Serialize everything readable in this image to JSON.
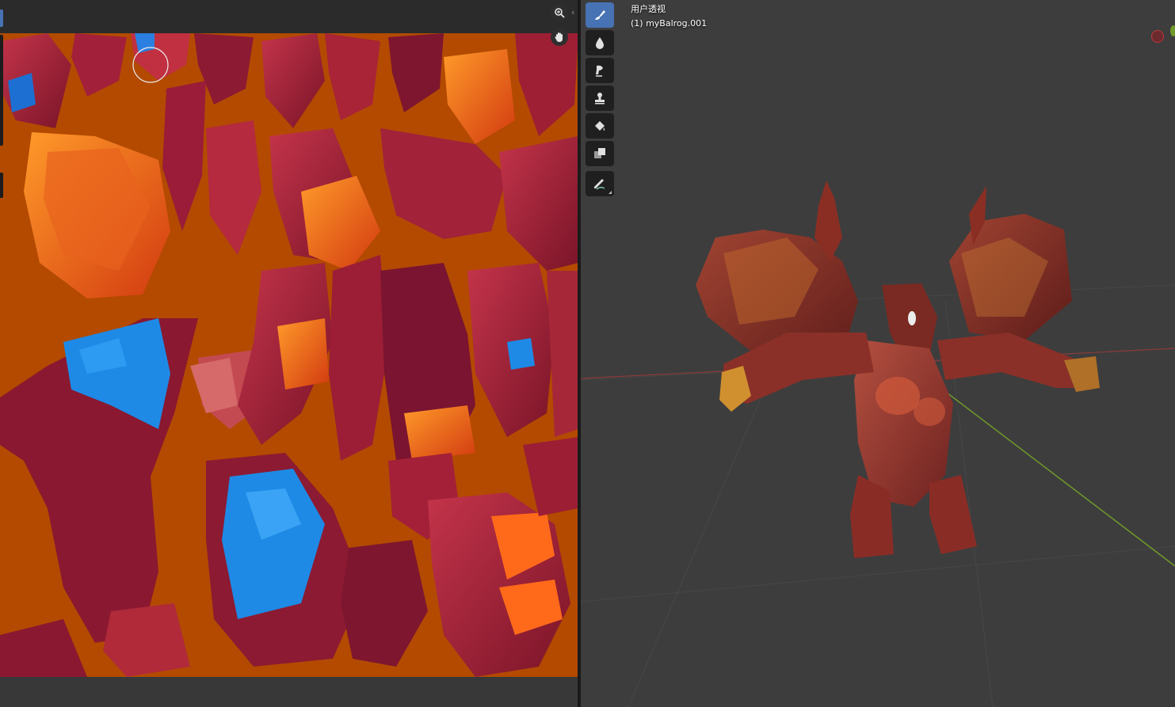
{
  "viewport": {
    "view_name": "用户透视",
    "object_label": "(1) myBalrog.001"
  },
  "image_editor": {
    "navigation": {
      "zoom_icon": "zoom-icon",
      "pan_icon": "hand-icon"
    },
    "canvas_background": "#b34a00"
  },
  "tool_shelf": {
    "tools": [
      {
        "name": "draw",
        "icon": "brush-icon",
        "active": true
      },
      {
        "name": "soften",
        "icon": "drop-icon",
        "active": false
      },
      {
        "name": "smear",
        "icon": "smear-icon",
        "active": false
      },
      {
        "name": "clone",
        "icon": "stamp-icon",
        "active": false
      },
      {
        "name": "fill",
        "icon": "bucket-icon",
        "active": false
      },
      {
        "name": "mask",
        "icon": "mask-icon",
        "active": false
      },
      {
        "name": "annotate",
        "icon": "pencil-icon",
        "active": false
      }
    ]
  },
  "colors": {
    "accent": "#4772b3",
    "editor_bg": "#2b2b2b",
    "viewport_bg": "#3d3d3d",
    "texture_orange": "#b34a00",
    "uv_blue": "#1e8ae6",
    "x_axis": "#c0363a",
    "y_axis": "#6f9a2a"
  }
}
